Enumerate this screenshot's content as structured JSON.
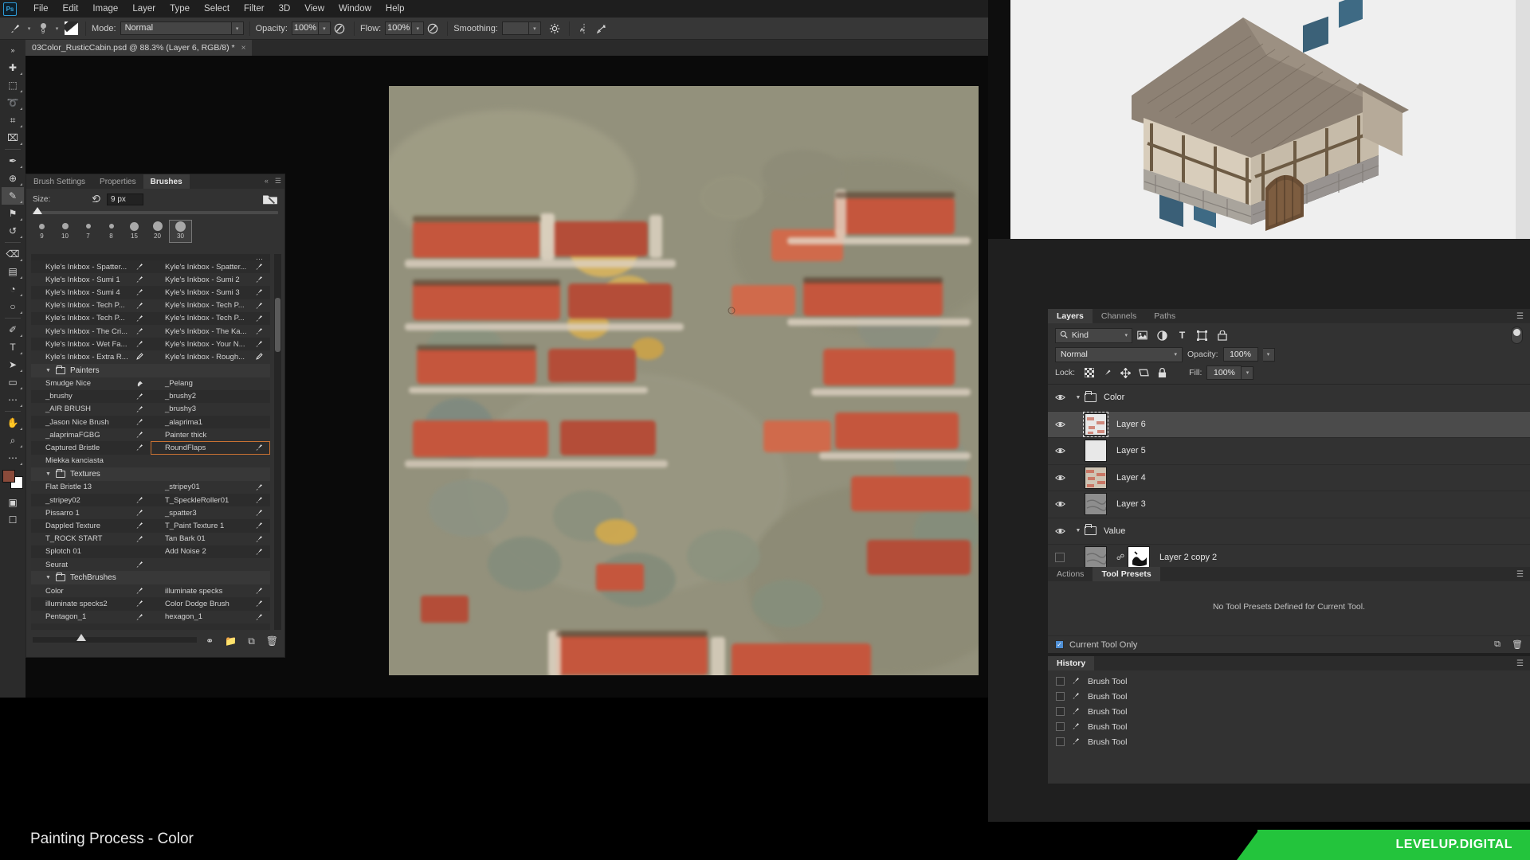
{
  "app": {
    "name": "Adobe Photoshop",
    "logo_text": "Ps"
  },
  "menubar": {
    "items": [
      "File",
      "Edit",
      "Image",
      "Layer",
      "Type",
      "Select",
      "Filter",
      "3D",
      "View",
      "Window",
      "Help"
    ]
  },
  "options_bar": {
    "brush_size_label": "9",
    "mode_label": "Mode:",
    "mode_value": "Normal",
    "opacity_label": "Opacity:",
    "opacity_value": "100%",
    "flow_label": "Flow:",
    "flow_value": "100%",
    "smoothing_label": "Smoothing:",
    "smoothing_value": ""
  },
  "document": {
    "tab_title": "03Color_RusticCabin.psd @ 88.3% (Layer 6, RGB/8) *",
    "close_glyph": "×",
    "zoom": "88.3%",
    "color_mode": "RGB/8",
    "active_layer": "Layer 6"
  },
  "toolbar": {
    "tools": [
      {
        "name": "move-tool",
        "glyph": "✚"
      },
      {
        "name": "marquee-tool",
        "glyph": "⬚"
      },
      {
        "name": "lasso-tool",
        "glyph": "➰"
      },
      {
        "name": "crop-tool",
        "glyph": "⌗"
      },
      {
        "name": "frame-tool",
        "glyph": "⌧"
      },
      {
        "name": "eyedropper-tool",
        "glyph": "✒"
      },
      {
        "name": "spot-healing-tool",
        "glyph": "⊕"
      },
      {
        "name": "brush-tool",
        "glyph": "✎"
      },
      {
        "name": "clone-stamp-tool",
        "glyph": "⚑"
      },
      {
        "name": "history-brush-tool",
        "glyph": "↺"
      },
      {
        "name": "eraser-tool",
        "glyph": "⌫"
      },
      {
        "name": "gradient-tool",
        "glyph": "▤"
      },
      {
        "name": "blur-tool",
        "glyph": "◔"
      },
      {
        "name": "dodge-tool",
        "glyph": "○"
      },
      {
        "name": "pen-tool",
        "glyph": "✐"
      },
      {
        "name": "type-tool",
        "glyph": "T"
      },
      {
        "name": "path-selection-tool",
        "glyph": "➤"
      },
      {
        "name": "rectangle-tool",
        "glyph": "▭"
      },
      {
        "name": "more-tools",
        "glyph": "⋯"
      },
      {
        "name": "hand-tool",
        "glyph": "✋"
      },
      {
        "name": "zoom-tool",
        "glyph": "⌕"
      },
      {
        "name": "edit-toolbar",
        "glyph": "⋯"
      }
    ],
    "foreground_color": "#8a4a3a",
    "background_color": "#ffffff"
  },
  "brushes_panel": {
    "tabs": [
      {
        "label": "Brush Settings",
        "active": false
      },
      {
        "label": "Properties",
        "active": false
      },
      {
        "label": "Brushes",
        "active": true
      }
    ],
    "size_label": "Size:",
    "size_value": "9 px",
    "reset_icon": "reset-icon",
    "presets": [
      {
        "size": "9"
      },
      {
        "size": "10"
      },
      {
        "size": "7"
      },
      {
        "size": "8"
      },
      {
        "size": "15"
      },
      {
        "size": "20"
      },
      {
        "size": "30"
      }
    ],
    "groups": [
      {
        "name": "",
        "is_group_header": false,
        "rows": [
          {
            "left": "Kyle's Inkbox - Spatter...",
            "right": "Kyle's Inkbox - Spatter...",
            "left_icon": "brush-icon",
            "right_icon": "brush-icon"
          },
          {
            "left": "Kyle's Inkbox - Sumi 1",
            "right": "Kyle's Inkbox - Sumi 2",
            "left_icon": "brush-icon",
            "right_icon": "brush-icon"
          },
          {
            "left": "Kyle's Inkbox - Sumi 4",
            "right": "Kyle's Inkbox - Sumi 3",
            "left_icon": "brush-icon",
            "right_icon": "brush-icon"
          },
          {
            "left": "Kyle's Inkbox - Tech P...",
            "right": "Kyle's Inkbox - Tech P...",
            "left_icon": "brush-icon",
            "right_icon": "brush-icon"
          },
          {
            "left": "Kyle's Inkbox - Tech P...",
            "right": "Kyle's Inkbox - Tech P...",
            "left_icon": "brush-icon",
            "right_icon": "brush-icon"
          },
          {
            "left": "Kyle's Inkbox - The Cri...",
            "right": "Kyle's Inkbox - The Ka...",
            "left_icon": "brush-icon",
            "right_icon": "brush-icon"
          },
          {
            "left": "Kyle's Inkbox - Wet Fa...",
            "right": "Kyle's Inkbox - Your N...",
            "left_icon": "brush-icon",
            "right_icon": "brush-icon"
          },
          {
            "left": "Kyle's Inkbox - Extra R...",
            "right": "Kyle's Inkbox - Rough...",
            "left_icon": "pencil-icon",
            "right_icon": "pencil-icon"
          }
        ]
      },
      {
        "name": "Painters",
        "is_group_header": true,
        "rows": [
          {
            "left": "Smudge Nice",
            "right": "_Pelang",
            "left_icon": "smudge-icon",
            "right_icon": ""
          },
          {
            "left": "_brushy",
            "right": "_brushy2",
            "left_icon": "brush-icon",
            "right_icon": ""
          },
          {
            "left": "_AIR BRUSH",
            "right": "_brushy3",
            "left_icon": "brush-icon",
            "right_icon": ""
          },
          {
            "left": "_Jason Nice Brush",
            "right": "_alaprima1",
            "left_icon": "brush-icon",
            "right_icon": ""
          },
          {
            "left": "_alaprimaFGBG",
            "right": "Painter thick",
            "left_icon": "brush-icon",
            "right_icon": ""
          },
          {
            "left": "Captured Bristle",
            "right": "RoundFlaps",
            "left_icon": "brush-icon",
            "right_icon": "brush-icon",
            "right_selected": true
          },
          {
            "left": "Miekka kanciasta",
            "right": "",
            "left_icon": "",
            "right_icon": ""
          }
        ]
      },
      {
        "name": "Textures",
        "is_group_header": true,
        "rows": [
          {
            "left": "Flat Bristle 13",
            "right": "_stripey01",
            "left_icon": "",
            "right_icon": "brush-icon"
          },
          {
            "left": "_stripey02",
            "right": "T_SpeckleRoller01",
            "left_icon": "brush-icon",
            "right_icon": "brush-icon"
          },
          {
            "left": "Pissarro 1",
            "right": "_spatter3",
            "left_icon": "brush-icon",
            "right_icon": "brush-icon"
          },
          {
            "left": "Dappled Texture",
            "right": "T_Paint Texture 1",
            "left_icon": "brush-icon",
            "right_icon": "brush-icon"
          },
          {
            "left": "T_ROCK START",
            "right": "Tan Bark 01",
            "left_icon": "brush-icon",
            "right_icon": "brush-icon"
          },
          {
            "left": "Splotch 01",
            "right": "Add Noise 2",
            "left_icon": "",
            "right_icon": "brush-icon"
          },
          {
            "left": "Seurat",
            "right": "",
            "left_icon": "brush-icon",
            "right_icon": ""
          }
        ]
      },
      {
        "name": "TechBrushes",
        "is_group_header": true,
        "rows": [
          {
            "left": "Color",
            "right": "illuminate specks",
            "left_icon": "brush-icon",
            "right_icon": "brush-icon"
          },
          {
            "left": "illuminate specks2",
            "right": "Color Dodge Brush",
            "left_icon": "brush-icon",
            "right_icon": "brush-icon"
          },
          {
            "left": "Pentagon_1",
            "right": "hexagon_1",
            "left_icon": "brush-icon",
            "right_icon": "brush-icon"
          }
        ]
      }
    ],
    "footer_icons": [
      "new-brush-preset-icon",
      "new-group-icon",
      "new-layer-icon",
      "delete-icon"
    ],
    "selected_brush": "RoundFlaps",
    "selection_color": "#c87133"
  },
  "layers_panel": {
    "tabs": [
      {
        "label": "Layers",
        "active": true
      },
      {
        "label": "Channels",
        "active": false
      },
      {
        "label": "Paths",
        "active": false
      }
    ],
    "filter_label": "Kind",
    "filter_icons": [
      "pixel-filter-icon",
      "adjustment-filter-icon",
      "type-filter-icon",
      "shape-filter-icon",
      "smart-object-filter-icon"
    ],
    "blend_mode": "Normal",
    "opacity_label": "Opacity:",
    "opacity_value": "100%",
    "lock_label": "Lock:",
    "lock_icons": [
      "lock-transparent-pixels-icon",
      "lock-image-pixels-icon",
      "lock-position-icon",
      "lock-artboard-icon",
      "lock-all-icon"
    ],
    "fill_label": "Fill:",
    "fill_value": "100%",
    "layers": [
      {
        "name": "Color",
        "type": "group",
        "visible": true,
        "expanded": true,
        "selected": false,
        "indent": 0,
        "thumb": "group"
      },
      {
        "name": "Layer 6",
        "type": "layer",
        "visible": true,
        "selected": true,
        "indent": 1,
        "thumb": "transparent-pink"
      },
      {
        "name": "Layer 5",
        "type": "layer",
        "visible": true,
        "selected": false,
        "indent": 1,
        "thumb": "transparent"
      },
      {
        "name": "Layer 4",
        "type": "layer",
        "visible": true,
        "selected": false,
        "indent": 1,
        "thumb": "pink-texture"
      },
      {
        "name": "Layer 3",
        "type": "layer",
        "visible": true,
        "selected": false,
        "indent": 1,
        "thumb": "gray-texture"
      },
      {
        "name": "Value",
        "type": "group",
        "visible": true,
        "expanded": true,
        "selected": false,
        "indent": 0,
        "thumb": "group"
      },
      {
        "name": "Layer 2 copy 2",
        "type": "layer",
        "visible": false,
        "selected": false,
        "indent": 1,
        "thumb": "gray-masked",
        "has_mask": true
      }
    ],
    "footer_icons": [
      "link-layers-icon",
      "add-layer-style-icon",
      "add-layer-mask-icon",
      "new-adjustment-layer-icon",
      "new-group-icon",
      "new-layer-icon",
      "delete-layer-icon"
    ]
  },
  "tool_presets_panel": {
    "tabs": [
      {
        "label": "Actions",
        "active": false
      },
      {
        "label": "Tool Presets",
        "active": true
      }
    ],
    "empty_message": "No Tool Presets Defined for Current Tool.",
    "current_tool_only_label": "Current Tool Only",
    "current_tool_only_checked": true,
    "checkbox_color": "#4f8fd4",
    "footer_icons": [
      "new-tool-preset-icon",
      "delete-tool-preset-icon"
    ]
  },
  "history_panel": {
    "tab_label": "History",
    "entries": [
      {
        "label": "Brush Tool"
      },
      {
        "label": "Brush Tool"
      },
      {
        "label": "Brush Tool"
      },
      {
        "label": "Brush Tool"
      },
      {
        "label": "Brush Tool"
      }
    ]
  },
  "bottom_bar": {
    "title": "Painting Process - Color",
    "brand": "LEVELUP.DIGITAL",
    "brand_color": "#23c43c"
  },
  "artwork": {
    "description": "Painted brick and stone wall study",
    "reference_description": "Rustic timber-frame cabin 3D render reference"
  }
}
